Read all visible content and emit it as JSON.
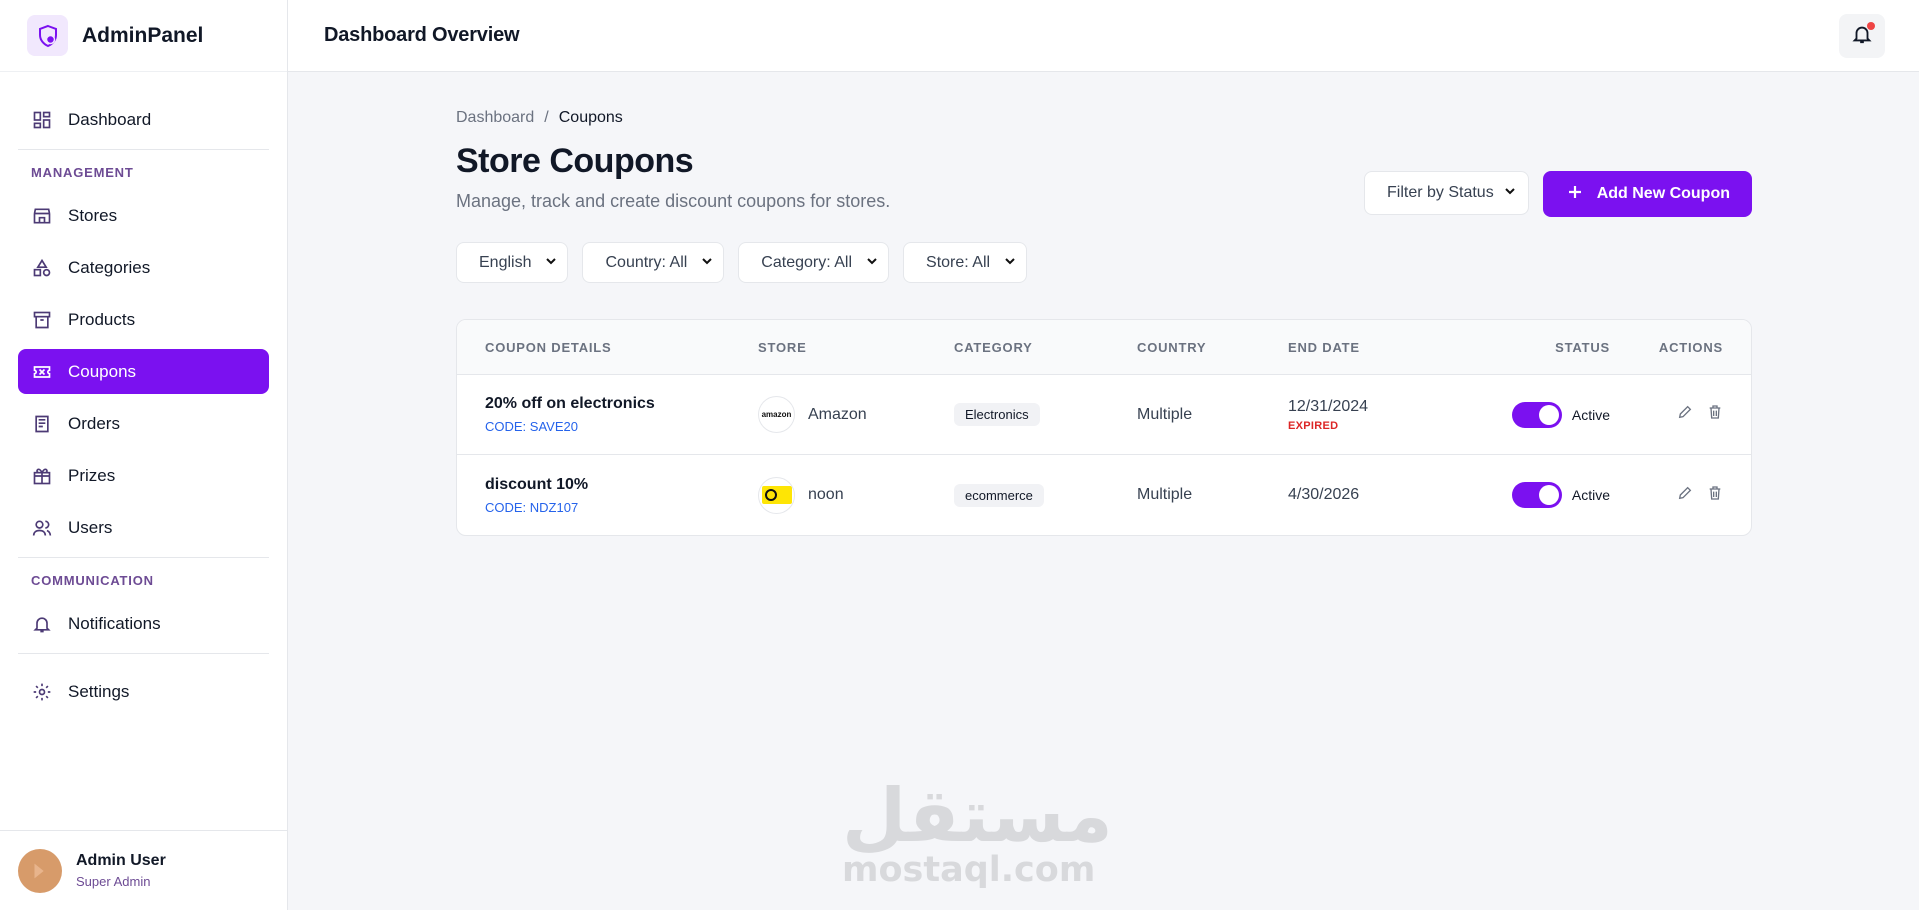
{
  "brand": {
    "name": "AdminPanel"
  },
  "sidebar": {
    "dashboard": "Dashboard",
    "section_management": "MANAGEMENT",
    "items": [
      {
        "label": "Stores",
        "icon": "store-icon"
      },
      {
        "label": "Categories",
        "icon": "shapes-icon"
      },
      {
        "label": "Products",
        "icon": "archive-icon"
      },
      {
        "label": "Coupons",
        "icon": "ticket-icon",
        "active": true
      },
      {
        "label": "Orders",
        "icon": "receipt-icon"
      },
      {
        "label": "Prizes",
        "icon": "gift-icon"
      },
      {
        "label": "Users",
        "icon": "users-icon"
      }
    ],
    "section_communication": "COMMUNICATION",
    "notifications": "Notifications",
    "settings": "Settings"
  },
  "user": {
    "name": "Admin User",
    "role": "Super Admin"
  },
  "topbar": {
    "title": "Dashboard Overview",
    "notification_icon": "bell-icon",
    "has_unread": true
  },
  "breadcrumb": {
    "root": "Dashboard",
    "separator": "/",
    "current": "Coupons"
  },
  "page": {
    "title": "Store Coupons",
    "subtitle": "Manage, track and create discount coupons for stores."
  },
  "header_actions": {
    "status_filter": "Filter by Status",
    "add_button": "Add New Coupon"
  },
  "filters": {
    "language": "English",
    "country": "Country: All",
    "category": "Category: All",
    "store": "Store: All"
  },
  "table": {
    "columns": [
      "COUPON DETAILS",
      "STORE",
      "CATEGORY",
      "COUNTRY",
      "END DATE",
      "STATUS",
      "ACTIONS"
    ],
    "rows": [
      {
        "title": "20% off on electronics",
        "code": "CODE: SAVE20",
        "store": "Amazon",
        "store_logo_text": "amazon",
        "category": "Electronics",
        "country": "Multiple",
        "end_date": "12/31/2024",
        "expired_label": "EXPIRED",
        "status": "Active",
        "enabled": true
      },
      {
        "title": "discount 10%",
        "code": "CODE: NDZ107",
        "store": "noon",
        "store_logo_text": "noon",
        "category": "ecommerce",
        "country": "Multiple",
        "end_date": "4/30/2026",
        "expired_label": "",
        "status": "Active",
        "enabled": true
      }
    ]
  },
  "watermark": {
    "arabic": "مستقل",
    "latin": "mostaql.com"
  },
  "colors": {
    "accent": "#7b11f0",
    "expired": "#dc2626",
    "code": "#2563eb",
    "section": "#6d4b94"
  }
}
